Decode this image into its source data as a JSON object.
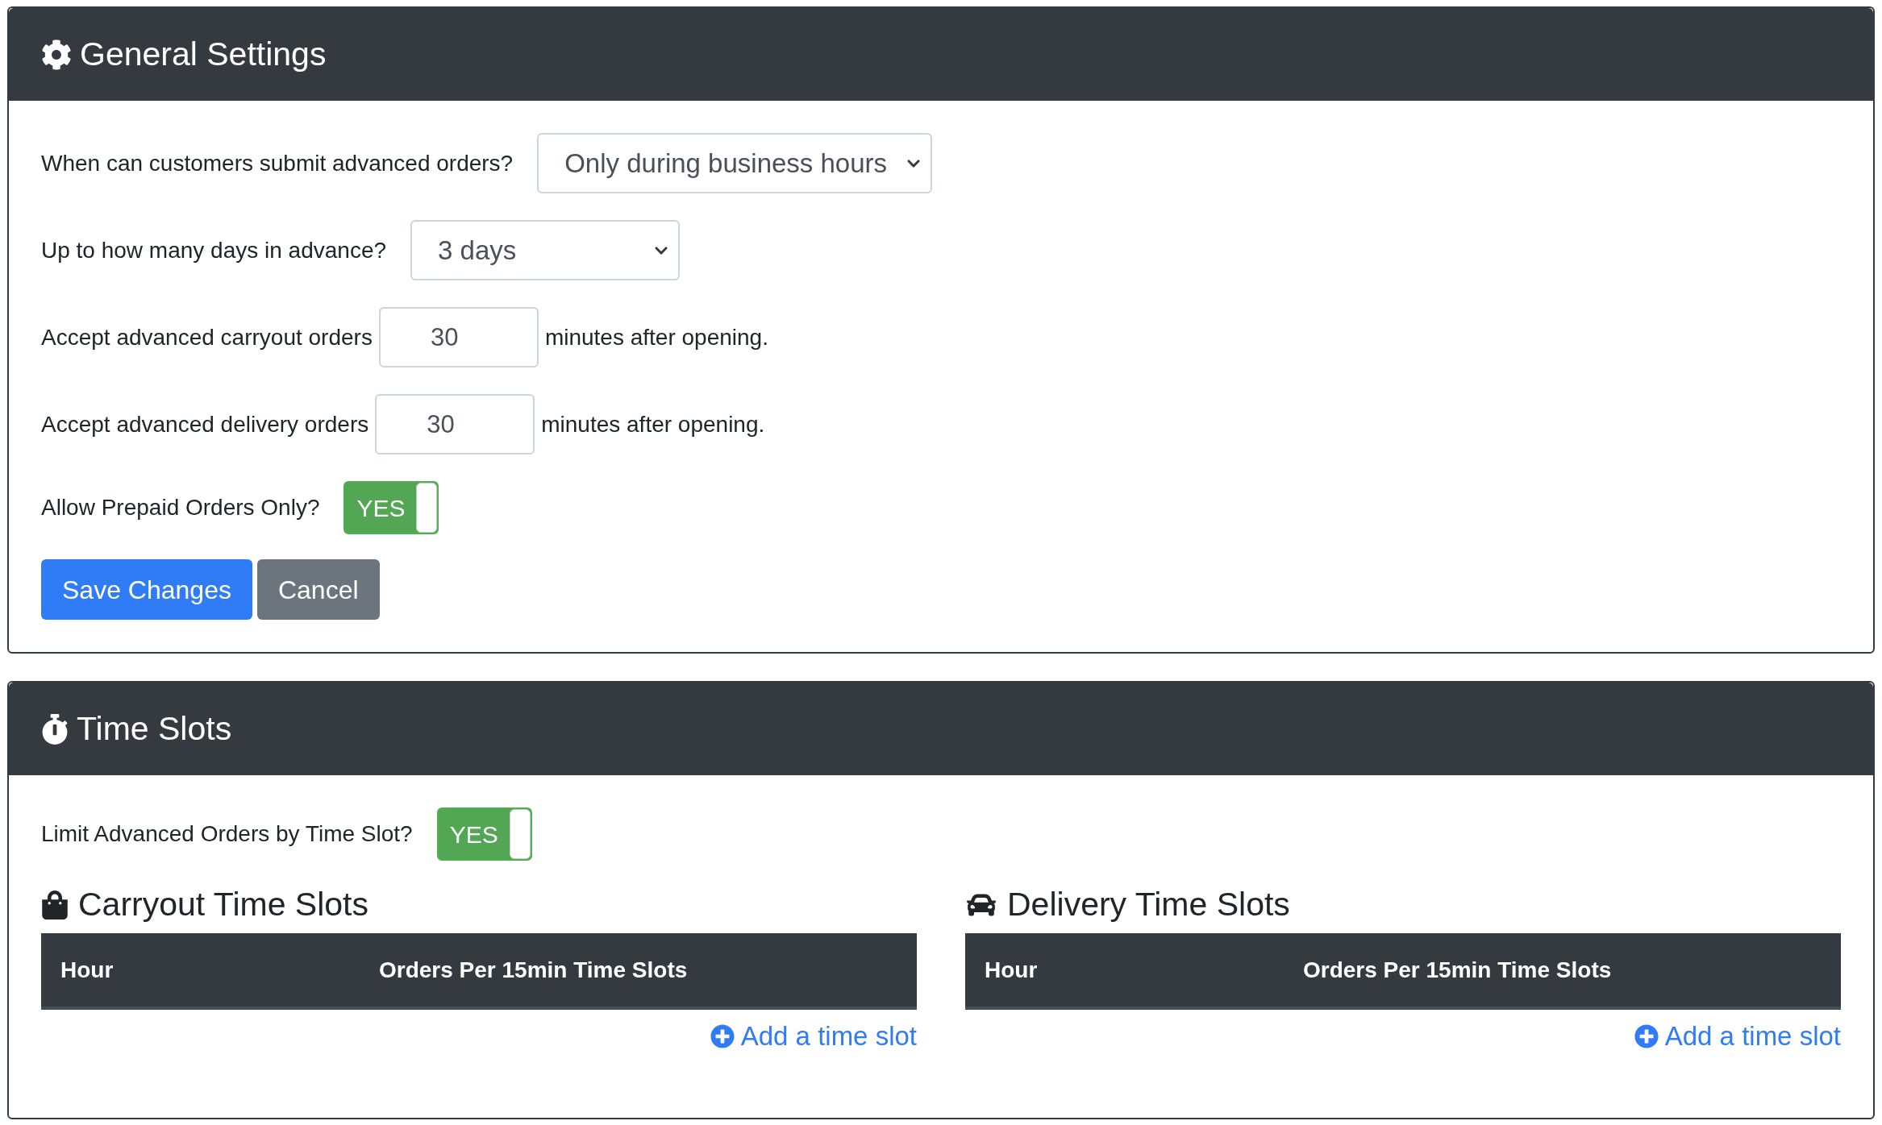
{
  "general_settings": {
    "title": "General Settings",
    "fields": [
      {
        "kind": "select",
        "label": "When can customers submit advanced orders?",
        "value": "Only during business hours"
      },
      {
        "kind": "select",
        "label": "Up to how many days in advance?",
        "value": "3 days"
      },
      {
        "kind": "input",
        "label": "Accept advanced carryout orders",
        "value": "30",
        "suffix": "minutes after opening."
      },
      {
        "kind": "input",
        "label": "Accept advanced delivery orders",
        "value": "30",
        "suffix": "minutes after opening."
      },
      {
        "kind": "toggle",
        "label": "Allow Prepaid Orders Only?",
        "on": true,
        "text": "YES"
      }
    ],
    "buttons": [
      {
        "kind": "primary",
        "label": "Save Changes"
      },
      {
        "kind": "secondary",
        "label": "Cancel"
      }
    ]
  },
  "time_slots": {
    "title": "Time Slots",
    "limit": {
      "label": "Limit Advanced Orders by Time Slot?",
      "on": true,
      "text": "YES"
    },
    "sections": [
      {
        "kind": "carryout",
        "title": "Carryout Time Slots",
        "columns": [
          "Hour",
          "Orders Per 15min Time Slots"
        ],
        "link": "Add a time slot"
      },
      {
        "kind": "delivery",
        "title": "Delivery Time Slots",
        "columns": [
          "Hour",
          "Orders Per 15min Time Slots"
        ],
        "link": "Add a time slot"
      }
    ]
  }
}
